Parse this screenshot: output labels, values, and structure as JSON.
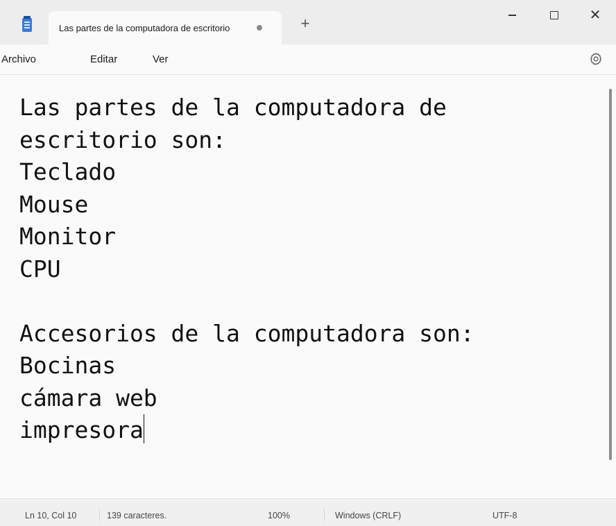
{
  "window": {
    "tab_title": "Las partes de la computadora de escritorio",
    "new_tab_label": "+",
    "close_glyph": "✕"
  },
  "menu": {
    "items": [
      "Archivo",
      "Editar",
      "Ver"
    ]
  },
  "editor": {
    "lines": [
      "Las partes de la computadora de",
      "escritorio son:",
      "Teclado",
      "Mouse",
      "Monitor",
      "CPU",
      "",
      "Accesorios de la computadora son:",
      "Bocinas",
      "cámara web",
      "impresora"
    ]
  },
  "status": {
    "position": "Ln 10, Col 10",
    "char_count": "139 caracteres.",
    "zoom": "100%",
    "line_ending": "Windows (CRLF)",
    "encoding": "UTF-8"
  },
  "colors": {
    "app_icon": "#3a7bd5",
    "unsaved_dot": "#8a8a8a"
  },
  "icons": {
    "app": "notepad-icon",
    "settings": "gear-icon",
    "unsaved": "unsaved-dot-icon"
  }
}
